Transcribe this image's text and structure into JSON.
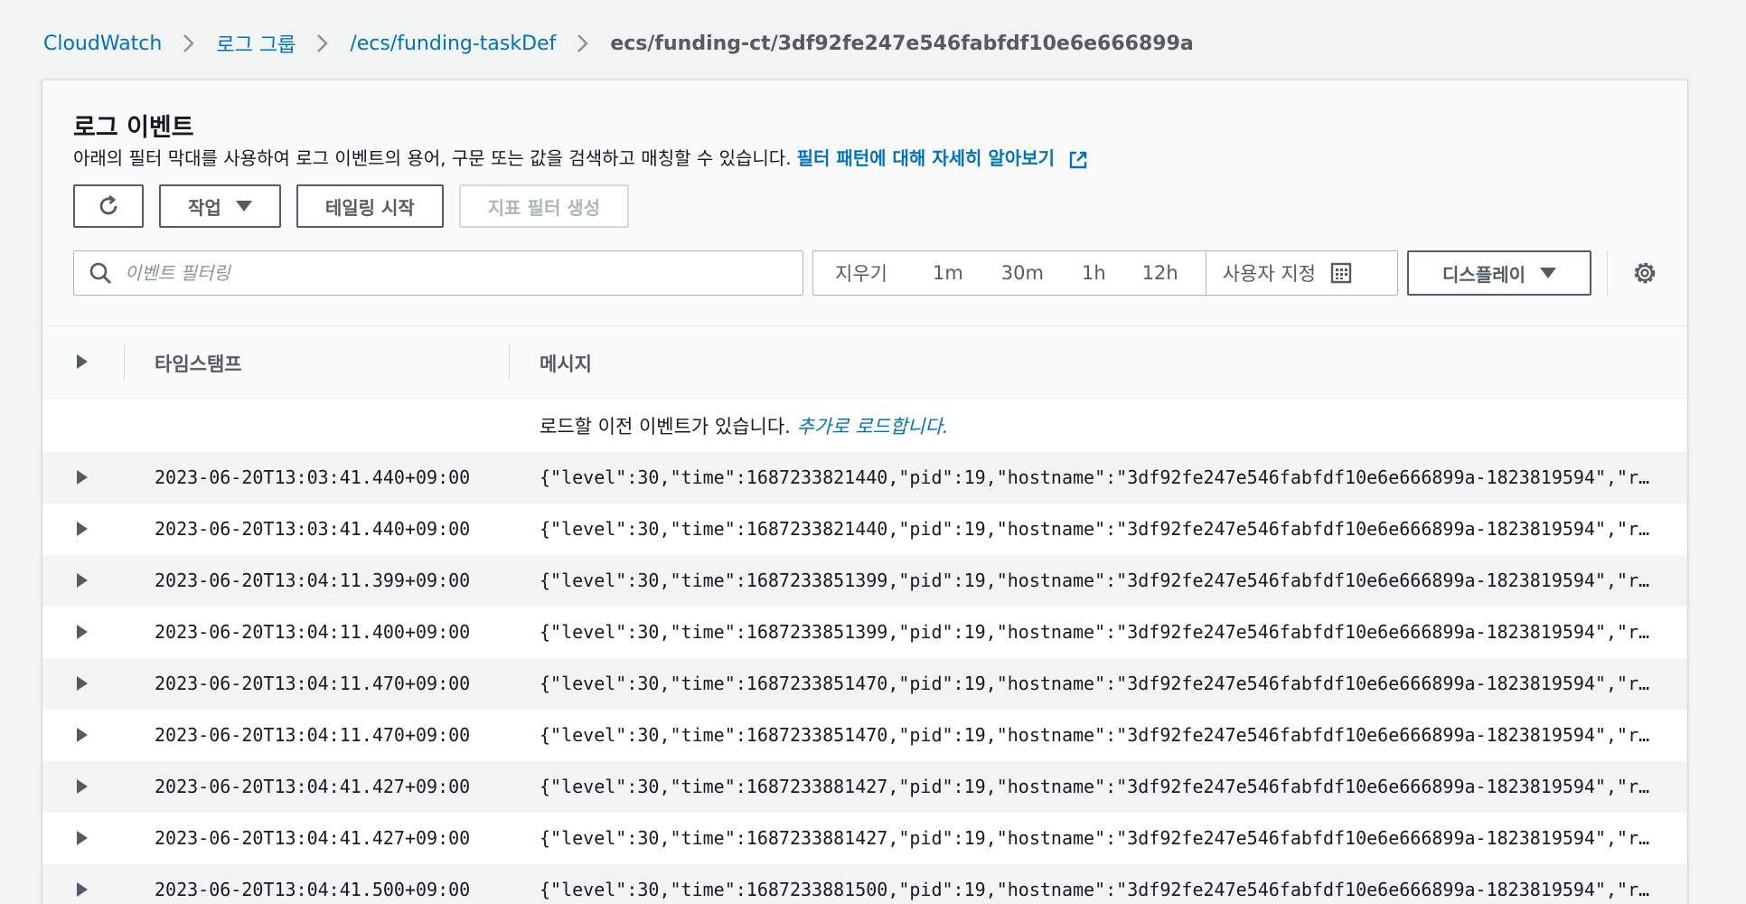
{
  "breadcrumb": {
    "items": [
      {
        "label": "CloudWatch"
      },
      {
        "label": "로그 그룹"
      },
      {
        "label": "/ecs/funding-taskDef"
      }
    ],
    "current": "ecs/funding-ct/3df92fe247e546fabfdf10e6e666899a"
  },
  "panel": {
    "title": "로그 이벤트",
    "description": "아래의 필터 막대를 사용하여 로그 이벤트의 용어, 구문 또는 값을 검색하고 매칭할 수 있습니다.",
    "learn_more": "필터 패턴에 대해 자세히 알아보기"
  },
  "toolbar": {
    "actions_label": "작업",
    "tailing_label": "테일링 시작",
    "metric_filter_label": "지표 필터 생성"
  },
  "filter": {
    "placeholder": "이벤트 필터링"
  },
  "time_range": {
    "clear": "지우기",
    "options": [
      "1m",
      "30m",
      "1h",
      "12h"
    ],
    "custom": "사용자 지정"
  },
  "display_label": "디스플레이",
  "table": {
    "columns": {
      "timestamp": "타임스탬프",
      "message": "메시지"
    },
    "load_prompt": "로드할 이전 이벤트가 있습니다.",
    "load_link": "추가로 로드합니다.",
    "rows": [
      {
        "timestamp": "2023-06-20T13:03:41.440+09:00",
        "message": "{\"level\":30,\"time\":1687233821440,\"pid\":19,\"hostname\":\"3df92fe247e546fabfdf10e6e666899a-1823819594\",\"req..."
      },
      {
        "timestamp": "2023-06-20T13:03:41.440+09:00",
        "message": "{\"level\":30,\"time\":1687233821440,\"pid\":19,\"hostname\":\"3df92fe247e546fabfdf10e6e666899a-1823819594\",\"req..."
      },
      {
        "timestamp": "2023-06-20T13:04:11.399+09:00",
        "message": "{\"level\":30,\"time\":1687233851399,\"pid\":19,\"hostname\":\"3df92fe247e546fabfdf10e6e666899a-1823819594\",\"req..."
      },
      {
        "timestamp": "2023-06-20T13:04:11.400+09:00",
        "message": "{\"level\":30,\"time\":1687233851399,\"pid\":19,\"hostname\":\"3df92fe247e546fabfdf10e6e666899a-1823819594\",\"req..."
      },
      {
        "timestamp": "2023-06-20T13:04:11.470+09:00",
        "message": "{\"level\":30,\"time\":1687233851470,\"pid\":19,\"hostname\":\"3df92fe247e546fabfdf10e6e666899a-1823819594\",\"req..."
      },
      {
        "timestamp": "2023-06-20T13:04:11.470+09:00",
        "message": "{\"level\":30,\"time\":1687233851470,\"pid\":19,\"hostname\":\"3df92fe247e546fabfdf10e6e666899a-1823819594\",\"req..."
      },
      {
        "timestamp": "2023-06-20T13:04:41.427+09:00",
        "message": "{\"level\":30,\"time\":1687233881427,\"pid\":19,\"hostname\":\"3df92fe247e546fabfdf10e6e666899a-1823819594\",\"req..."
      },
      {
        "timestamp": "2023-06-20T13:04:41.427+09:00",
        "message": "{\"level\":30,\"time\":1687233881427,\"pid\":19,\"hostname\":\"3df92fe247e546fabfdf10e6e666899a-1823819594\",\"req..."
      },
      {
        "timestamp": "2023-06-20T13:04:41.500+09:00",
        "message": "{\"level\":30,\"time\":1687233881500,\"pid\":19,\"hostname\":\"3df92fe247e546fabfdf10e6e666899a-1823819594\",\"req..."
      }
    ]
  },
  "icons": {
    "refresh": "refresh-icon",
    "external": "external-link-icon",
    "search": "search-icon",
    "calendar": "calendar-icon",
    "settings": "gear-icon",
    "expand": "caret-right-icon"
  },
  "colors": {
    "link": "#0073bb",
    "text": "#16191f",
    "muted": "#545b64",
    "background": "#f2f3f3"
  }
}
